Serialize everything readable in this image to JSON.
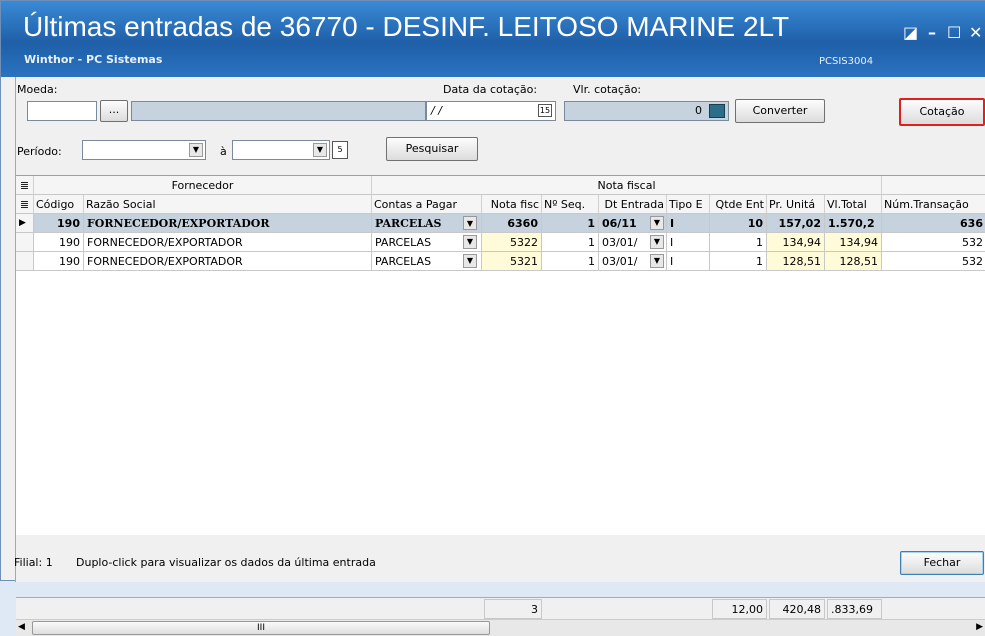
{
  "window": {
    "title": "Últimas entradas de 36770 - DESINF. LEITOSO MARINE 2LT",
    "subtitle": "Winthor - PC Sistemas",
    "program_code": "PCSIS3004"
  },
  "form": {
    "moeda_label": "Moeda:",
    "moeda_code": "",
    "moeda_btn": "...",
    "moeda_desc": "",
    "data_cotacao_label": "Data da cotação:",
    "data_cotacao_value": "/ /",
    "vlr_cotacao_label": "Vlr. cotação:",
    "vlr_cotacao_value": "0",
    "converter_label": "Converter",
    "cotacao_label": "Cotação",
    "periodo_label": "Período:",
    "a_label": "à",
    "periodo_inicio": "",
    "periodo_fim": "",
    "pesquisar_label": "Pesquisar"
  },
  "grid": {
    "band_fornecedor": "Fornecedor",
    "band_nota": "Nota fiscal",
    "columns": [
      "Código",
      "Razão Social",
      "Contas a Pagar",
      "Nota fisc",
      "Nº Seq.",
      "Dt Entrada",
      "Tipo E",
      "Qtde Ent",
      "Pr. Unitá",
      "Vl.Total",
      "Núm.Transação"
    ],
    "rows": [
      {
        "codigo": "190",
        "razao": "FORNECEDOR/EXPORTADOR",
        "contas": "PARCELAS",
        "nota": "6360",
        "seq": "1",
        "dt": "06/11",
        "tipo": "I",
        "qtde": "10",
        "pr": "157,02",
        "vl": "1.570,2",
        "trans": "636"
      },
      {
        "codigo": "190",
        "razao": "FORNECEDOR/EXPORTADOR",
        "contas": "PARCELAS",
        "nota": "5322",
        "seq": "1",
        "dt": "03/01/",
        "tipo": "I",
        "qtde": "1",
        "pr": "134,94",
        "vl": "134,94",
        "trans": "532"
      },
      {
        "codigo": "190",
        "razao": "FORNECEDOR/EXPORTADOR",
        "contas": "PARCELAS",
        "nota": "5321",
        "seq": "1",
        "dt": "03/01/",
        "tipo": "I",
        "qtde": "1",
        "pr": "128,51",
        "vl": "128,51",
        "trans": "532"
      }
    ],
    "footer": {
      "nota_count": "3",
      "qtde_total": "12,00",
      "pr_total": "420,48",
      "vl_total": ".833,69"
    },
    "scroll_grip": "III"
  },
  "status": {
    "filial": "Filial: 1",
    "hint": "Duplo-click para visualizar os dados da última entrada",
    "fechar_label": "Fechar"
  },
  "colors": {
    "title_bar": "#2b73c0",
    "highlight_border": "#e02020",
    "row_selected": "#c6d2de",
    "money_cell": "#fffbd9"
  }
}
